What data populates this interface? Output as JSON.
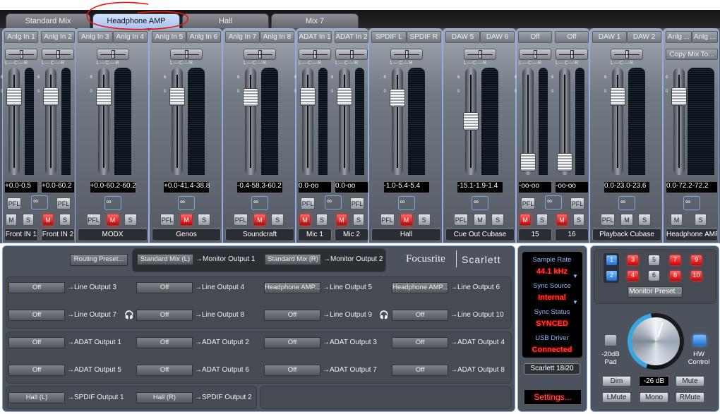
{
  "tabs": [
    {
      "label": "Standard Mix",
      "active": false
    },
    {
      "label": "Headphone AMP",
      "active": true
    },
    {
      "label": "Hall",
      "active": false
    },
    {
      "label": "Mix 7",
      "active": false
    }
  ],
  "groups": [
    {
      "type": "pair",
      "linked": false,
      "strips": [
        {
          "input": "Anlg In 1",
          "name": "Front IN 1",
          "values": [
            "+0.0",
            "-0.5"
          ],
          "fader": 0.78,
          "muted": false
        },
        {
          "input": "Anlg In 2",
          "name": "Front IN 2",
          "values": [
            "+0.0",
            "-60.2"
          ],
          "fader": 0.78,
          "muted": true
        }
      ]
    },
    {
      "type": "stereo",
      "linked": true,
      "inputs": [
        "Anlg In 3",
        "Anlg In 4"
      ],
      "name": "MODX",
      "values": [
        "+0.0",
        "-60.2",
        "-60.2"
      ],
      "fader": 0.78,
      "muted": true
    },
    {
      "type": "stereo",
      "linked": true,
      "inputs": [
        "Anlg In 5",
        "Anlg In 6"
      ],
      "name": "Genos",
      "values": [
        "+0.0",
        "-41.4",
        "-38.8"
      ],
      "fader": 0.78,
      "muted": true
    },
    {
      "type": "stereo",
      "linked": true,
      "inputs": [
        "Anlg In 7",
        "Anlg In 8"
      ],
      "name": "Soundcraft",
      "values": [
        "-0.4",
        "-58.3",
        "-60.2"
      ],
      "fader": 0.77,
      "muted": true
    },
    {
      "type": "pair",
      "linked": false,
      "strips": [
        {
          "input": "ADAT In 1",
          "name": "Mic 1",
          "values": [
            "0.0",
            "-oo"
          ],
          "fader": 0.78,
          "muted": true
        },
        {
          "input": "ADAT In 2",
          "name": "Mic 2",
          "values": [
            "0.0",
            "-oo"
          ],
          "fader": 0.78,
          "muted": true
        }
      ]
    },
    {
      "type": "stereo",
      "linked": true,
      "inputs": [
        "SPDIF L",
        "SPDIF R"
      ],
      "name": "Hall",
      "values": [
        "-1.0",
        "-5.4",
        "-5.4"
      ],
      "fader": 0.76,
      "muted": true
    },
    {
      "type": "stereo",
      "linked": true,
      "inputs": [
        "DAW 5",
        "DAW 6"
      ],
      "name": "Cue Out Cubase",
      "values": [
        "-15.1",
        "-1.9",
        "-1.4"
      ],
      "fader": 0.5,
      "muted": false
    },
    {
      "type": "pair",
      "linked": false,
      "strips": [
        {
          "input": "Off",
          "name": "15",
          "values": [
            "-oo",
            "-oo"
          ],
          "fader": 0.04,
          "muted": true
        },
        {
          "input": "Off",
          "name": "16",
          "values": [
            "-oo",
            "-oo"
          ],
          "fader": 0.04,
          "muted": true
        }
      ]
    },
    {
      "type": "stereo",
      "linked": true,
      "inputs": [
        "DAW 1",
        "DAW 2"
      ],
      "name": "Playback Cubase",
      "values": [
        "0.0",
        "-23.0",
        "-23.6"
      ],
      "fader": 0.78,
      "muted": false
    },
    {
      "type": "master",
      "linked": true,
      "inputs": [
        "Anlg ...",
        "Anlg ..."
      ],
      "copy_label": "Copy Mix To...",
      "name": "Headphone AMP",
      "values": [
        "0.0",
        "-72.2",
        "-72.2"
      ],
      "fader": 0.78,
      "muted": false
    }
  ],
  "strip_labels": {
    "pfl": "PFL",
    "mute": "M",
    "solo": "S",
    "pan": "L—C—R",
    "scale_top": "6",
    "scale_0": "0",
    "link": "∞"
  },
  "routing": {
    "preset_button": "Routing Preset...",
    "monitor": [
      {
        "source": "Standard Mix (L)",
        "dest": "→Monitor Output 1"
      },
      {
        "source": "Standard Mix (R)",
        "dest": "→Monitor Output 2"
      }
    ],
    "rows": [
      [
        {
          "source": "Off",
          "dest": "→Line Output 3"
        },
        {
          "source": "Off",
          "dest": "→Line Output 4"
        },
        {
          "source": "Headphone AMP...",
          "dest": "→Line Output 5"
        },
        {
          "source": "Headphone AMP...",
          "dest": "→Line Output 6"
        }
      ],
      [
        {
          "source": "Off",
          "dest": "→Line Output 7"
        },
        {
          "source": "Off",
          "dest": "→Line Output 8"
        },
        {
          "source": "Off",
          "dest": "→Line Output 9"
        },
        {
          "source": "Off",
          "dest": "→Line Output 10"
        }
      ],
      [
        {
          "source": "Off",
          "dest": "→ADAT Output 1"
        },
        {
          "source": "Off",
          "dest": "→ADAT Output 2"
        },
        {
          "source": "Off",
          "dest": "→ADAT Output 3"
        },
        {
          "source": "Off",
          "dest": "→ADAT Output 4"
        }
      ],
      [
        {
          "source": "Off",
          "dest": "→ADAT Output 5"
        },
        {
          "source": "Off",
          "dest": "→ADAT Output 6"
        },
        {
          "source": "Off",
          "dest": "→ADAT Output 7"
        },
        {
          "source": "Off",
          "dest": "→ADAT Output 8"
        }
      ],
      [
        {
          "source": "Hall (L)",
          "dest": "→SPDIF Output 1"
        },
        {
          "source": "Hall (R)",
          "dest": "→SPDIF Output 2"
        }
      ]
    ]
  },
  "brand": {
    "maker": "Focusrite",
    "product": "Scarlett"
  },
  "status": {
    "sample_rate_label": "Sample Rate",
    "sample_rate": "44.1 kHz",
    "sync_source_label": "Sync Source",
    "sync_source": "Internal",
    "sync_status_label": "Sync Status",
    "sync_status": "SYNCED",
    "usb_label": "USB  Driver",
    "usb": "Connected",
    "device": "Scarlett 18i20",
    "settings": "Settings..."
  },
  "monitor": {
    "buttons": [
      {
        "label": "1",
        "state": "blue"
      },
      {
        "label": "2",
        "state": "blue"
      },
      {
        "label": "3",
        "state": "red"
      },
      {
        "label": "4",
        "state": "red"
      },
      {
        "label": "5",
        "state": "off"
      },
      {
        "label": "6",
        "state": "off"
      },
      {
        "label": "7",
        "state": "red"
      },
      {
        "label": "8",
        "state": "red"
      },
      {
        "label": "9",
        "state": "red"
      },
      {
        "label": "10",
        "state": "red"
      }
    ],
    "preset_button": "Monitor Preset...",
    "pad_label": "-20dB Pad",
    "pad_on": false,
    "hw_label": "HW Control",
    "hw_on": true,
    "level": "-26 dB",
    "dim": "Dim",
    "mute": "Mute",
    "lmute": "LMute",
    "mono": "Mono",
    "rmute": "RMute"
  },
  "colors": {
    "active_tab": "#b8cdf0",
    "mute_red": "#e02020",
    "link_blue": "#1f6fd1",
    "status_red": "#ff3b3b"
  }
}
